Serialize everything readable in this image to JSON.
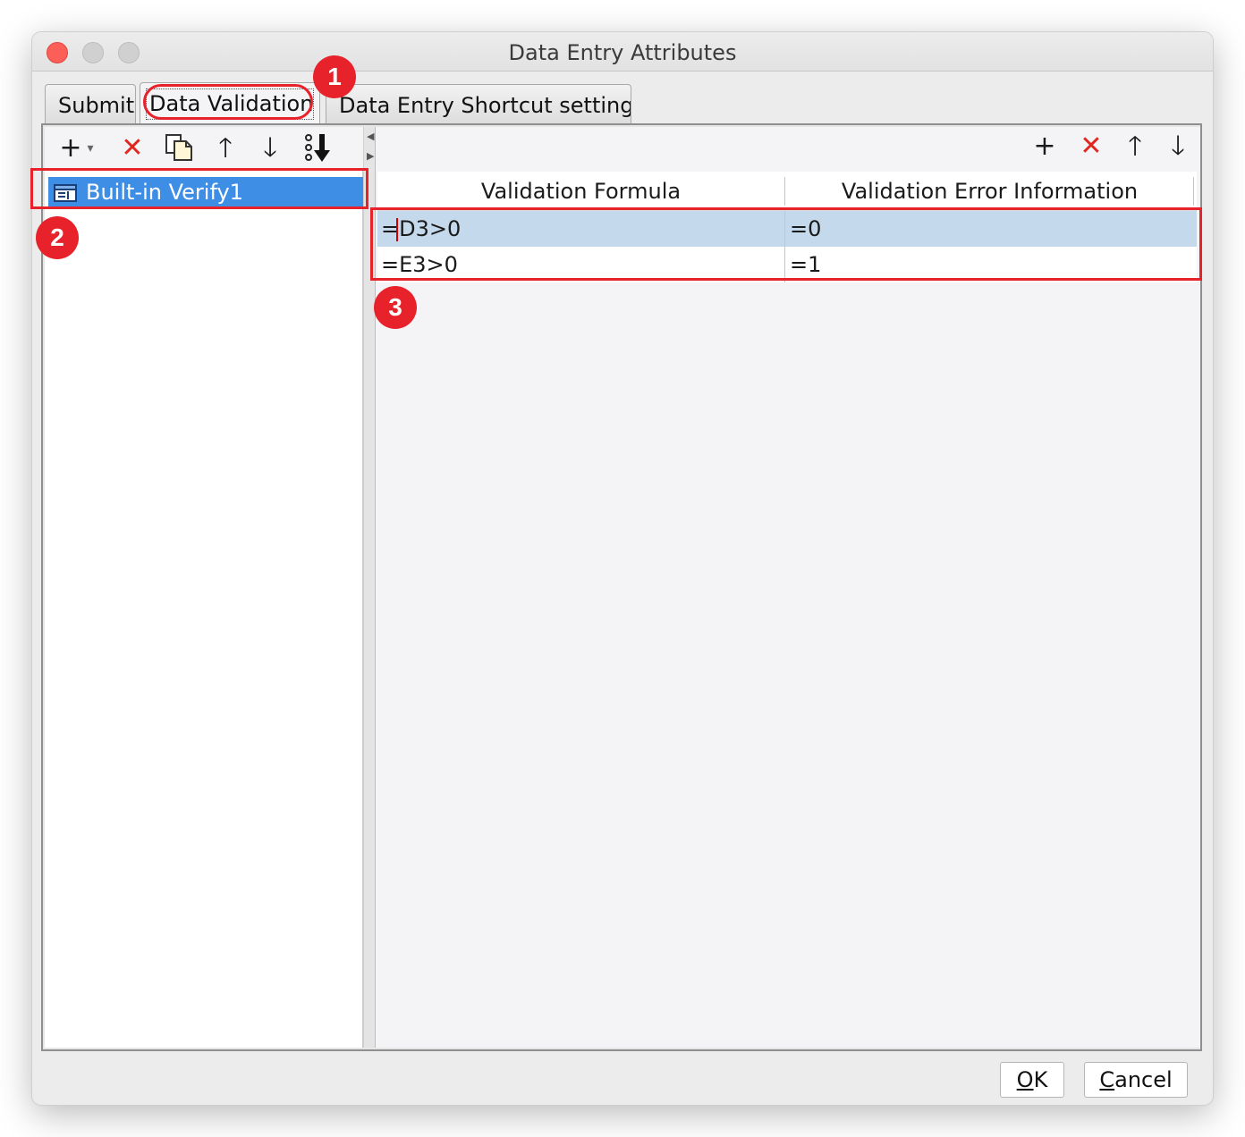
{
  "window": {
    "title": "Data Entry Attributes"
  },
  "tabs": [
    {
      "label": "Submit"
    },
    {
      "label": "Data Validation"
    },
    {
      "label": "Data Entry Shortcut settings"
    }
  ],
  "left_toolbar": {
    "add_icon": "+",
    "add_dropdown_icon": "▾",
    "delete_icon": "✕",
    "copy_icon": "copy-icon",
    "up_icon": "🡑",
    "down_icon": "🡓",
    "move_bottom_icon": "move-to-bottom-icon"
  },
  "verify_list": {
    "items": [
      {
        "label": "Built-in Verify1"
      }
    ]
  },
  "right_toolbar": {
    "add_icon": "+",
    "delete_icon": "✕",
    "up_icon": "🡑",
    "down_icon": "🡓"
  },
  "table": {
    "headers": [
      "Validation Formula",
      "Validation Error Information"
    ],
    "rows": [
      {
        "formula": "=D3>0",
        "error": "=0"
      },
      {
        "formula": "=E3>0",
        "error": "=1"
      }
    ]
  },
  "annotations": [
    "1",
    "2",
    "3"
  ],
  "buttons": {
    "ok_mn": "O",
    "ok_rest": "K",
    "cancel_mn": "C",
    "cancel_rest": "ancel"
  },
  "colors": {
    "selection": "#3f8ee6",
    "row_highlight": "#c4d9ec",
    "annotation": "#e8222a",
    "delete": "#e0271f"
  }
}
